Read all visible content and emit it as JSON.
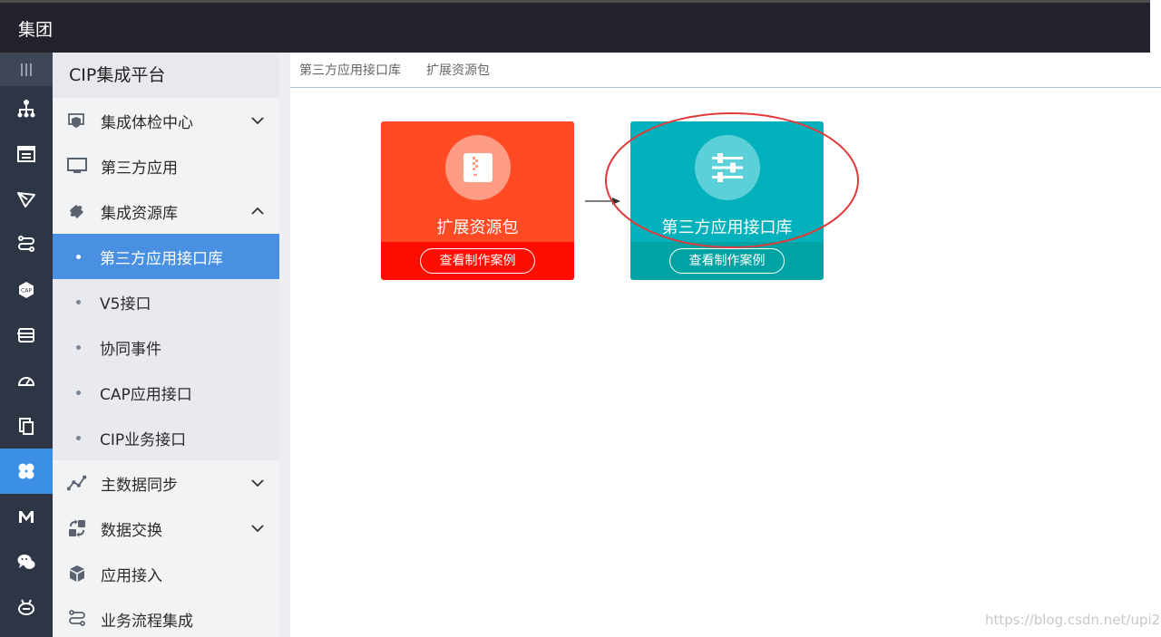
{
  "header": {
    "title": "集团"
  },
  "rail": {
    "icons": [
      "menu-lines-icon",
      "org-chart-icon",
      "form-icon",
      "send-icon",
      "flow-icon",
      "cap-hex-icon",
      "database-icon",
      "gauge-icon",
      "copy-icon",
      "clover-icon",
      "m-letter-icon",
      "wechat-icon",
      "robot-icon"
    ],
    "cap_text": "CAP",
    "active_index": 9
  },
  "subnav": {
    "title": "CIP集成平台",
    "items": [
      {
        "label": "集成体检中心",
        "icon": "shield-monitor-icon",
        "chevron": "down"
      },
      {
        "label": "第三方应用",
        "icon": "monitor-icon"
      },
      {
        "label": "集成资源库",
        "icon": "puzzle-icon",
        "chevron": "up"
      }
    ],
    "subitems": [
      {
        "label": "第三方应用接口库",
        "active": true
      },
      {
        "label": "V5接口"
      },
      {
        "label": "协同事件"
      },
      {
        "label": "CAP应用接口"
      },
      {
        "label": "CIP业务接口"
      }
    ],
    "items_after": [
      {
        "label": "主数据同步",
        "icon": "line-chart-icon",
        "chevron": "down"
      },
      {
        "label": "数据交换",
        "icon": "exchange-icon",
        "chevron": "down"
      },
      {
        "label": "应用接入",
        "icon": "cube-icon"
      },
      {
        "label": "业务流程集成",
        "icon": "flow-icon"
      }
    ]
  },
  "breadcrumb": [
    "第三方应用接口库",
    "扩展资源包"
  ],
  "cards": [
    {
      "title": "扩展资源包",
      "button": "查看制作案例",
      "icon": "zip-file-icon"
    },
    {
      "title": "第三方应用接口库",
      "button": "查看制作案例",
      "icon": "sliders-icon"
    }
  ],
  "colors": {
    "accent": "#4a90e2",
    "orange": "#ff4a23",
    "teal": "#02b1bc",
    "annotation": "#e23a3a"
  },
  "watermark": "https://blog.csdn.net/upi2u"
}
